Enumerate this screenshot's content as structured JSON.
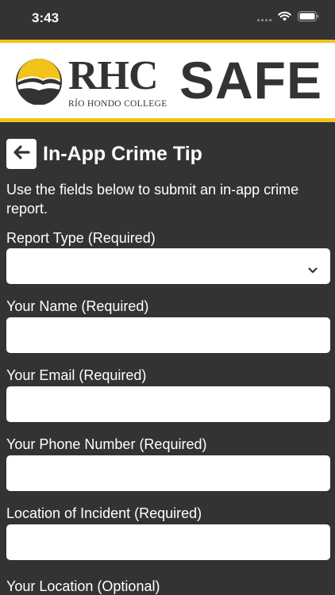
{
  "status_bar": {
    "time": "3:43"
  },
  "header": {
    "logo_text": "RHC",
    "college_name": "RÍO HONDO COLLEGE",
    "brand": "SAFE",
    "colors": {
      "accent": "#f2c318",
      "dark": "#333333"
    }
  },
  "page": {
    "back_icon": "arrow-left-icon",
    "title": "In-App Crime Tip",
    "intro": "Use the fields below to submit an in-app crime report."
  },
  "form": {
    "report_type": {
      "label": "Report Type (Required)",
      "value": ""
    },
    "name": {
      "label": "Your Name (Required)",
      "value": ""
    },
    "email": {
      "label": "Your Email (Required)",
      "value": ""
    },
    "phone": {
      "label": "Your Phone Number (Required)",
      "value": ""
    },
    "incident_location": {
      "label": "Location of Incident (Required)",
      "value": ""
    },
    "your_location": {
      "label": "Your Location (Optional)"
    }
  }
}
